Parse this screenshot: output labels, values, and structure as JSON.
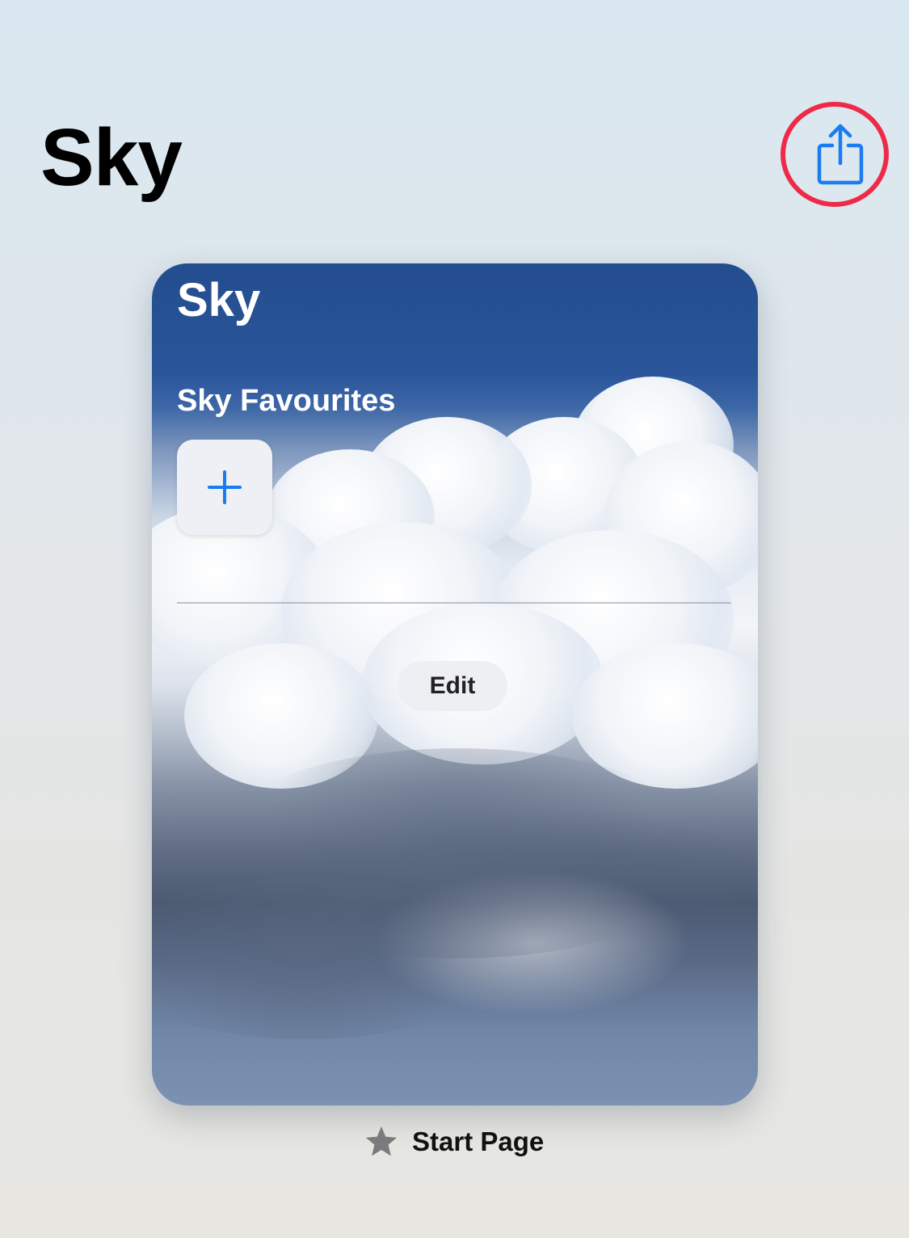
{
  "header": {
    "title": "Sky",
    "share_icon": "share-icon",
    "accent_color": "#1a7cf0",
    "highlight_color": "#ee2a48"
  },
  "preview_card": {
    "title": "Sky",
    "favourites_title": "Sky Favourites",
    "add_icon": "plus-icon",
    "edit_label": "Edit",
    "background": "sky-cloud-image"
  },
  "footer": {
    "icon": "star-icon",
    "label": "Start Page"
  }
}
